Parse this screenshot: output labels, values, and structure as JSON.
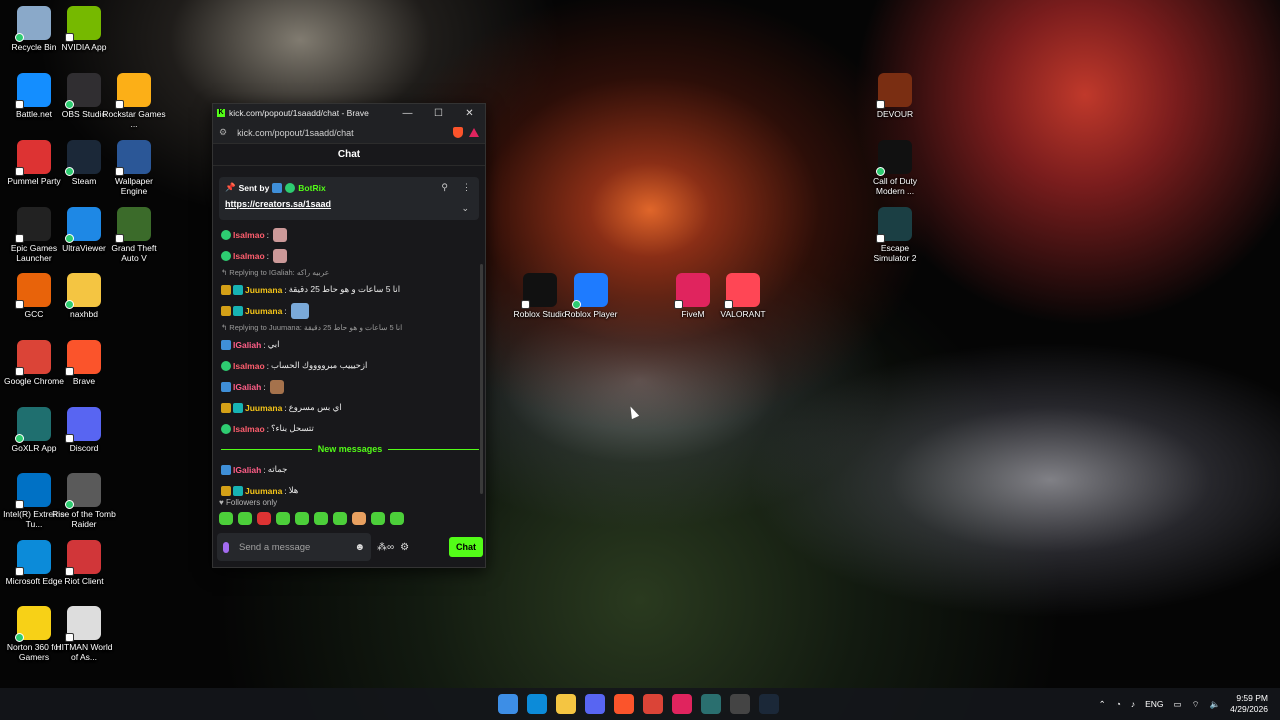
{
  "desktop_icons": [
    {
      "label": "Recycle Bin",
      "icon": "recycle-bin-icon",
      "color": "#8aa9c9"
    },
    {
      "label": "NVIDIA App",
      "icon": "nvidia-icon",
      "color": "#76b900"
    },
    {
      "label": "Battle.net",
      "icon": "battlenet-icon",
      "color": "#148eff"
    },
    {
      "label": "OBS Studio",
      "icon": "obs-icon",
      "color": "#302e31"
    },
    {
      "label": "Rockstar Games ...",
      "icon": "rockstar-icon",
      "color": "#fcaf17"
    },
    {
      "label": "Pummel Party",
      "icon": "pummel-party-icon",
      "color": "#d33"
    },
    {
      "label": "Steam",
      "icon": "steam-icon",
      "color": "#1b2838"
    },
    {
      "label": "Wallpaper Engine",
      "icon": "wallpaper-engine-icon",
      "color": "#2b5797"
    },
    {
      "label": "Epic Games Launcher",
      "icon": "epic-games-icon",
      "color": "#222"
    },
    {
      "label": "UltraViewer",
      "icon": "ultraviewer-icon",
      "color": "#1e88e5"
    },
    {
      "label": "Grand Theft Auto V",
      "icon": "gta-icon",
      "color": "#3b6b2a"
    },
    {
      "label": "GCC",
      "icon": "gcc-icon",
      "color": "#e8630a"
    },
    {
      "label": "naxhbd",
      "icon": "folder-icon",
      "color": "#f4c542"
    },
    {
      "label": "Google Chrome",
      "icon": "chrome-icon",
      "color": "#db4437"
    },
    {
      "label": "Brave",
      "icon": "brave-icon",
      "color": "#fb542b"
    },
    {
      "label": "GoXLR App",
      "icon": "goxlr-icon",
      "color": "#1f6f6f"
    },
    {
      "label": "Discord",
      "icon": "discord-icon",
      "color": "#5865f2"
    },
    {
      "label": "Intel(R) Extreme Tu...",
      "icon": "intel-icon",
      "color": "#0071c5"
    },
    {
      "label": "Rise of the Tomb Raider",
      "icon": "tomb-raider-icon",
      "color": "#5a5a5a"
    },
    {
      "label": "Microsoft Edge",
      "icon": "edge-icon",
      "color": "#0c8bd9"
    },
    {
      "label": "Riot Client",
      "icon": "riot-icon",
      "color": "#d13639"
    },
    {
      "label": "Norton 360 for Gamers",
      "icon": "norton-icon",
      "color": "#f7d117"
    },
    {
      "label": "HITMAN World of As...",
      "icon": "hitman-icon",
      "color": "#ddd"
    },
    {
      "label": "DEVOUR",
      "icon": "devour-icon",
      "color": "#7a2e12"
    },
    {
      "label": "Call of Duty Modern ...",
      "icon": "cod-icon",
      "color": "#111"
    },
    {
      "label": "Escape Simulator 2",
      "icon": "escape-sim-icon",
      "color": "#1b3f44"
    },
    {
      "label": "Roblox Studio",
      "icon": "roblox-studio-icon",
      "color": "#111"
    },
    {
      "label": "Roblox Player",
      "icon": "roblox-player-icon",
      "color": "#1e7bff"
    },
    {
      "label": "FiveM",
      "icon": "fivem-icon",
      "color": "#e0245e"
    },
    {
      "label": "VALORANT",
      "icon": "valorant-icon",
      "color": "#ff4655"
    }
  ],
  "window": {
    "title": "kick.com/popout/1saadd/chat - Brave",
    "url": "kick.com/popout/1saadd/chat",
    "minimize": "—",
    "maximize": "☐",
    "close": "✕"
  },
  "chat": {
    "header": "Chat",
    "pinned": {
      "sent_by": "Sent by",
      "user": "BotRix",
      "link": "https://creators.sa/1saad"
    },
    "messages": [
      {
        "type": "msg",
        "user": "Isalmao",
        "user_class": "u-red",
        "badges": [
          "green"
        ],
        "text": "",
        "emote": "emote"
      },
      {
        "type": "msg",
        "user": "Isalmao",
        "user_class": "u-red",
        "badges": [
          "green"
        ],
        "text": "",
        "emote": "emote"
      },
      {
        "type": "reply",
        "text": "Replying to IGaliah: عربيه راكه"
      },
      {
        "type": "msg",
        "user": "Juumana",
        "user_class": "u-yellow",
        "badges": [
          "crown",
          "teal"
        ],
        "text": "انا 5 ساعات و هو حاط 25 دقيقة"
      },
      {
        "type": "msg",
        "user": "Juumana",
        "user_class": "u-yellow",
        "badges": [
          "crown",
          "teal"
        ],
        "text": "",
        "emote": "emote wide"
      },
      {
        "type": "reply",
        "text": "Replying to Juumana: انا 5 ساعات و هو حاط 25 دقيقة"
      },
      {
        "type": "msg",
        "user": "IGaliah",
        "user_class": "u-pink",
        "badges": [
          "blue"
        ],
        "text": "ابي"
      },
      {
        "type": "msg",
        "user": "Isalmao",
        "user_class": "u-red",
        "badges": [
          "green"
        ],
        "text": "ازحيييب مبرووووك الحساب"
      },
      {
        "type": "msg",
        "user": "IGaliah",
        "user_class": "u-pink",
        "badges": [
          "blue"
        ],
        "text": "",
        "emote": "emote face"
      },
      {
        "type": "msg",
        "user": "Juumana",
        "user_class": "u-yellow",
        "badges": [
          "crown",
          "teal"
        ],
        "text": "اي بس مسروع"
      },
      {
        "type": "msg",
        "user": "Isalmao",
        "user_class": "u-red",
        "badges": [
          "green"
        ],
        "text": "تتسحل بناء؟"
      }
    ],
    "new_messages_label": "New messages",
    "new_messages": [
      {
        "user": "IGaliah",
        "user_class": "u-pink",
        "badges": [
          "blue"
        ],
        "text": "جماته"
      },
      {
        "user": "Juumana",
        "user_class": "u-yellow",
        "badges": [
          "crown",
          "teal"
        ],
        "text": "هلا"
      }
    ],
    "followers_only": "Followers only",
    "input_placeholder": "Send a message",
    "send_label": "Chat"
  },
  "taskbar": {
    "language": "ENG",
    "time": "9:59 PM",
    "date": "4/29/2026",
    "apps": [
      "windows-start-icon",
      "edge-icon",
      "file-explorer-icon",
      "discord-icon",
      "brave-icon",
      "chrome-icon",
      "fivem-icon",
      "goxlr-icon",
      "obs-icon",
      "steam-icon"
    ]
  }
}
